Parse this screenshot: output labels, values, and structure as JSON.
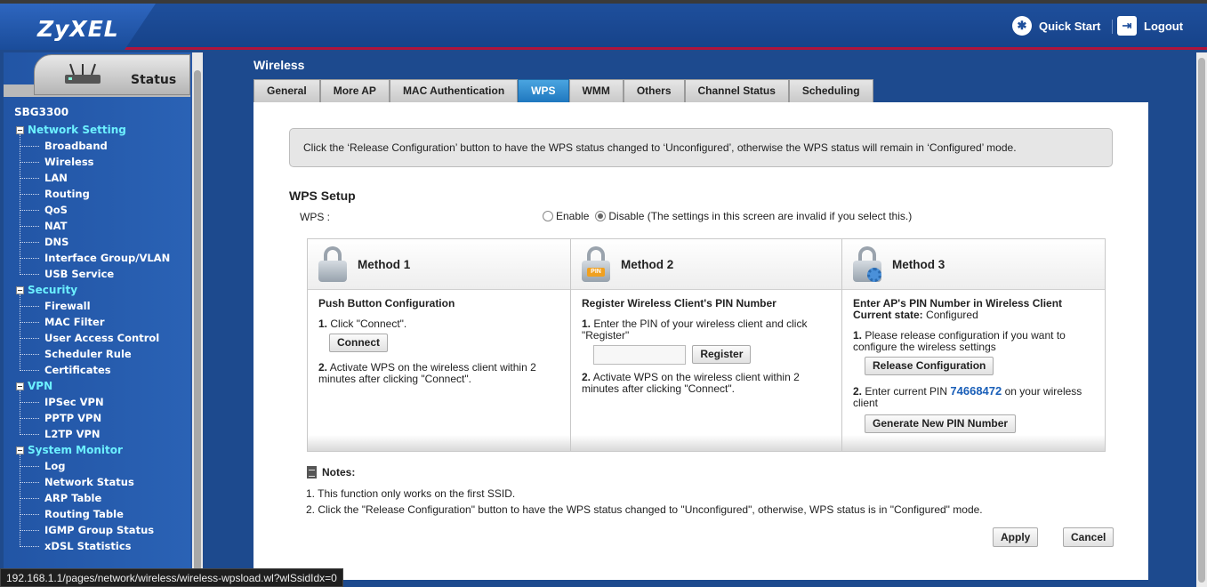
{
  "header": {
    "brand": "ZyXEL",
    "quick_start": "Quick Start",
    "logout": "Logout"
  },
  "sidebar": {
    "status_label": "Status",
    "device": "SBG3300",
    "groups": [
      {
        "label": "Network Setting",
        "items": [
          "Broadband",
          "Wireless",
          "LAN",
          "Routing",
          "QoS",
          "NAT",
          "DNS",
          "Interface Group/VLAN",
          "USB Service"
        ]
      },
      {
        "label": "Security",
        "items": [
          "Firewall",
          "MAC Filter",
          "User Access Control",
          "Scheduler Rule",
          "Certificates"
        ]
      },
      {
        "label": "VPN",
        "items": [
          "IPSec VPN",
          "PPTP VPN",
          "L2TP VPN"
        ]
      },
      {
        "label": "System Monitor",
        "items": [
          "Log",
          "Network Status",
          "ARP Table",
          "Routing Table",
          "IGMP Group Status",
          "xDSL Statistics"
        ]
      }
    ]
  },
  "page": {
    "title": "Wireless",
    "tabs": [
      "General",
      "More AP",
      "MAC Authentication",
      "WPS",
      "WMM",
      "Others",
      "Channel Status",
      "Scheduling"
    ],
    "active_tab": "WPS",
    "info": "Click the ‘Release Configuration’ button to have the WPS status changed to ‘Unconfigured’, otherwise the WPS status will remain in ‘Configured’ mode.",
    "section_title": "WPS Setup",
    "wps_label": "WPS :",
    "enable_label": "Enable",
    "disable_label": "Disable (The settings in this screen are invalid if you select this.)",
    "wps_selected": "Disable"
  },
  "methods": {
    "m1": {
      "title": "Method 1",
      "heading": "Push Button Configuration",
      "step1_num": "1.",
      "step1": "Click \"Connect\".",
      "connect": "Connect",
      "step2_num": "2.",
      "step2": "Activate WPS on the wireless client within 2 minutes after clicking \"Connect\"."
    },
    "m2": {
      "title": "Method 2",
      "heading": "Register Wireless Client's PIN Number",
      "step1_num": "1.",
      "step1": "Enter the PIN of your wireless client and click \"Register\"",
      "pin_input_value": "",
      "register": "Register",
      "step2_num": "2.",
      "step2": "Activate WPS on the wireless client within 2 minutes after clicking \"Connect\"."
    },
    "m3": {
      "title": "Method 3",
      "heading": "Enter AP's PIN Number in Wireless Client",
      "state_label": "Current state:",
      "state_value": "Configured",
      "step1_num": "1.",
      "step1": "Please release configuration if you want to configure the wireless settings",
      "release": "Release Configuration",
      "step2_num": "2.",
      "step2_pre": "Enter current PIN",
      "pin": "74668472",
      "step2_post": "on your wireless client",
      "generate": "Generate New PIN Number"
    }
  },
  "notes": {
    "title": "Notes:",
    "n1": "1. This function only works on the first SSID.",
    "n2": "2. Click the \"Release Configuration\" button to have the WPS status changed to \"Unconfigured\", otherwise, WPS status is in \"Configured\" mode."
  },
  "actions": {
    "apply": "Apply",
    "cancel": "Cancel"
  },
  "statusbar": {
    "url": "192.168.1.1/pages/network/wireless/wireless-wpsload.wl?wlSsidIdx=0"
  }
}
